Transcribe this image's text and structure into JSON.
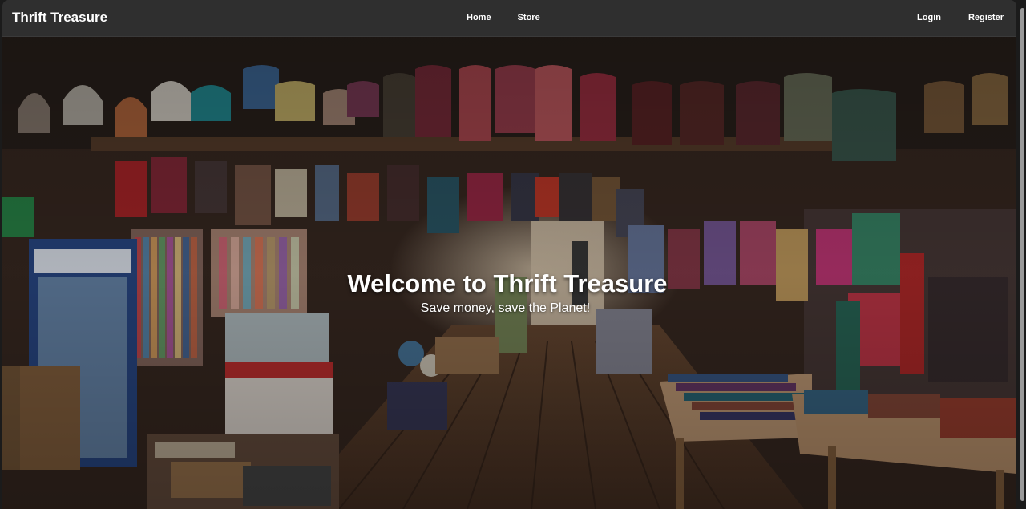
{
  "brand": {
    "name": "Thrift Treasure"
  },
  "nav": {
    "home": "Home",
    "store": "Store",
    "login": "Login",
    "register": "Register"
  },
  "hero": {
    "title": "Welcome to Thrift Treasure",
    "subtitle": "Save money, save the Planet!",
    "image_description_icon": "market-stall-photo"
  },
  "colors": {
    "navbar_bg": "#2f2f2f",
    "text": "#ffffff",
    "page_bg": "#1b1b1b"
  }
}
